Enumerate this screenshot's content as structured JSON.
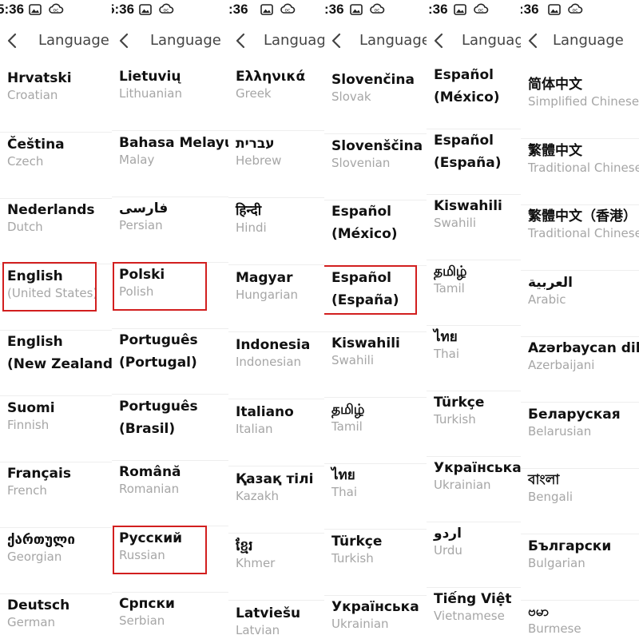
{
  "status": {
    "time": "5:36",
    "time_cut": ":36"
  },
  "header": {
    "title": "Language",
    "title_cut": "Languag"
  },
  "colors": {
    "highlight": "#d21f1f",
    "native_text": "#111111",
    "english_text": "#a6a6a6",
    "header_text": "#444444"
  },
  "icons": [
    "back-chevron-icon",
    "image-icon",
    "cloud-icon"
  ],
  "screens": [
    {
      "items": [
        {
          "native": "Hrvatski",
          "english": "Croatian"
        },
        {
          "native": "Čeština",
          "english": "Czech"
        },
        {
          "native": "Nederlands",
          "english": "Dutch"
        },
        {
          "native": "English",
          "english": "(United States)"
        },
        {
          "native": "English",
          "native2": "(New Zealand)"
        },
        {
          "native": "Suomi",
          "english": "Finnish"
        },
        {
          "native": "Français",
          "english": "French"
        },
        {
          "native": "ქართული",
          "english": "Georgian"
        },
        {
          "native": "Deutsch",
          "english": "German"
        }
      ]
    },
    {
      "items": [
        {
          "native": "Lietuvių",
          "english": "Lithuanian"
        },
        {
          "native": "Bahasa Melayu",
          "english": "Malay"
        },
        {
          "native": "فارسی",
          "english": "Persian"
        },
        {
          "native": "Polski",
          "english": "Polish"
        },
        {
          "native": "Português",
          "native2": "(Portugal)"
        },
        {
          "native": "Português",
          "native2": "(Brasil)"
        },
        {
          "native": "Română",
          "english": "Romanian"
        },
        {
          "native": "Русский",
          "english": "Russian"
        },
        {
          "native": "Српски",
          "english": "Serbian"
        }
      ]
    },
    {
      "items": [
        {
          "native": "Ελληνικά",
          "english": "Greek"
        },
        {
          "native": "עברית",
          "english": "Hebrew"
        },
        {
          "native": "हिन्दी",
          "english": "Hindi"
        },
        {
          "native": "Magyar",
          "english": "Hungarian"
        },
        {
          "native": "Indonesia",
          "english": "Indonesian"
        },
        {
          "native": "Italiano",
          "english": "Italian"
        },
        {
          "native": "Қазақ тілі",
          "english": "Kazakh"
        },
        {
          "native": "ខ្មែរ",
          "english": "Khmer"
        },
        {
          "native": "Latviešu",
          "english": "Latvian"
        }
      ]
    },
    {
      "items": [
        {
          "native": "Slovenčina",
          "english": "Slovak"
        },
        {
          "native": "Slovenščina",
          "english": "Slovenian"
        },
        {
          "native": "Español",
          "native2": "(México)"
        },
        {
          "native": "Español",
          "native2": "(España)"
        },
        {
          "native": "Kiswahili",
          "english": "Swahili"
        },
        {
          "native": "தமிழ்",
          "english": "Tamil"
        },
        {
          "native": "ไทย",
          "english": "Thai"
        },
        {
          "native": "Türkçe",
          "english": "Turkish"
        },
        {
          "native": "Українська",
          "english": "Ukrainian"
        }
      ]
    },
    {
      "items": [
        {
          "native": "Español",
          "native2": "(México)"
        },
        {
          "native": "Español",
          "native2": "(España)"
        },
        {
          "native": "Kiswahili",
          "english": "Swahili"
        },
        {
          "native": "தமிழ்",
          "english": "Tamil"
        },
        {
          "native": "ไทย",
          "english": "Thai"
        },
        {
          "native": "Türkçe",
          "english": "Turkish"
        },
        {
          "native": "Українська",
          "english": "Ukrainian"
        },
        {
          "native": "اردو",
          "english": "Urdu"
        },
        {
          "native": "Tiếng Việt",
          "english": "Vietnamese"
        }
      ]
    },
    {
      "items": [
        {
          "native": "简体中文",
          "english": "Simplified Chinese"
        },
        {
          "native": "繁體中文",
          "english": "Traditional Chinese"
        },
        {
          "native": "繁體中文（香港）",
          "english": "Traditional Chinese"
        },
        {
          "native": "العربية",
          "english": "Arabic"
        },
        {
          "native": "Azərbaycan dili",
          "english": "Azerbaijani"
        },
        {
          "native": "Беларуская",
          "english": "Belarusian"
        },
        {
          "native": "বাংলা",
          "english": "Bengali"
        },
        {
          "native": "Български",
          "english": "Bulgarian"
        },
        {
          "native": "ဗမာ",
          "english": "Burmese"
        }
      ]
    }
  ]
}
